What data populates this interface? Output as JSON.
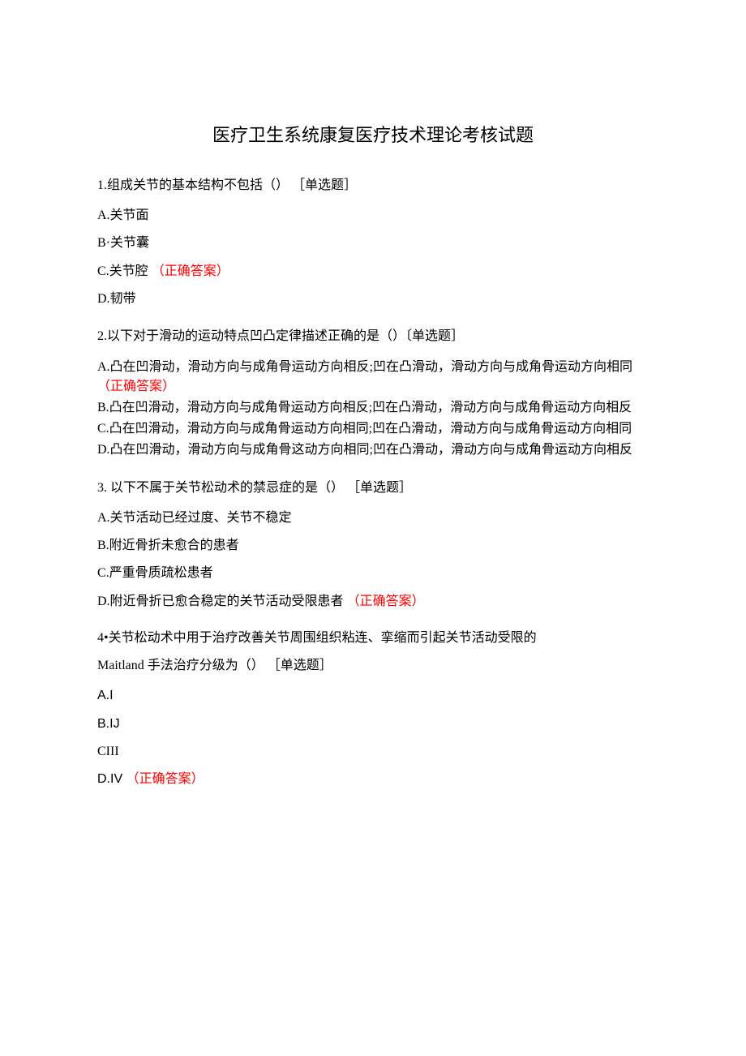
{
  "title": "医疗卫生系统康复医疗技术理论考核试题",
  "correct_label": "（正确答案）",
  "correct_label_paren": "（正确答案）",
  "questions": [
    {
      "stem": "1.组成关节的基本结构不包括（） ［单选题］",
      "options": {
        "a": "A.关节面",
        "b": "B·关节囊",
        "c_prefix": "C.关节腔",
        "d": "D.韧带"
      }
    },
    {
      "stem": "2.以下对于滑动的运动特点凹凸定律描述正确的是（）〔单选题］",
      "options": {
        "a_prefix": "A.凸在凹滑动，滑动方向与成角骨运动方向相反;凹在凸滑动，滑动方向与成角骨运动方向相同",
        "b": "B.凸在凹滑动，滑动方向与成角骨运动方向相反;凹在凸滑动，滑动方向与成角骨运动方向相反",
        "c": "C.凸在凹滑动，滑动方向与成角骨运动方向相同;凹在凸滑动，滑动方向与成角骨运动方向相同",
        "d": "D.凸在凹滑动，滑动方向与成角骨这动方向相同;凹在凸滑动，滑动方向与成角骨运动方向相反"
      }
    },
    {
      "stem": "3. 以下不属于关节松动术的禁忌症的是（） ［单选题］",
      "options": {
        "a": "A.关节活动已经过度、关节不稳定",
        "b": "B.附近骨折未愈合的患者",
        "c": "C.严重骨质疏松患者",
        "d_prefix": "D.附近骨折已愈合稳定的关节活动受限患者"
      }
    },
    {
      "stem_line1": "4•关节松动术中用于治疗改善关节周围组织粘连、挛缩而引起关节活动受限的",
      "stem_line2": "Maitland 手法治疗分级为（） ［单选题］",
      "options": {
        "a": "A.I",
        "b": "B.IJ",
        "c": "CIII",
        "d_prefix": "D.IV"
      }
    }
  ]
}
